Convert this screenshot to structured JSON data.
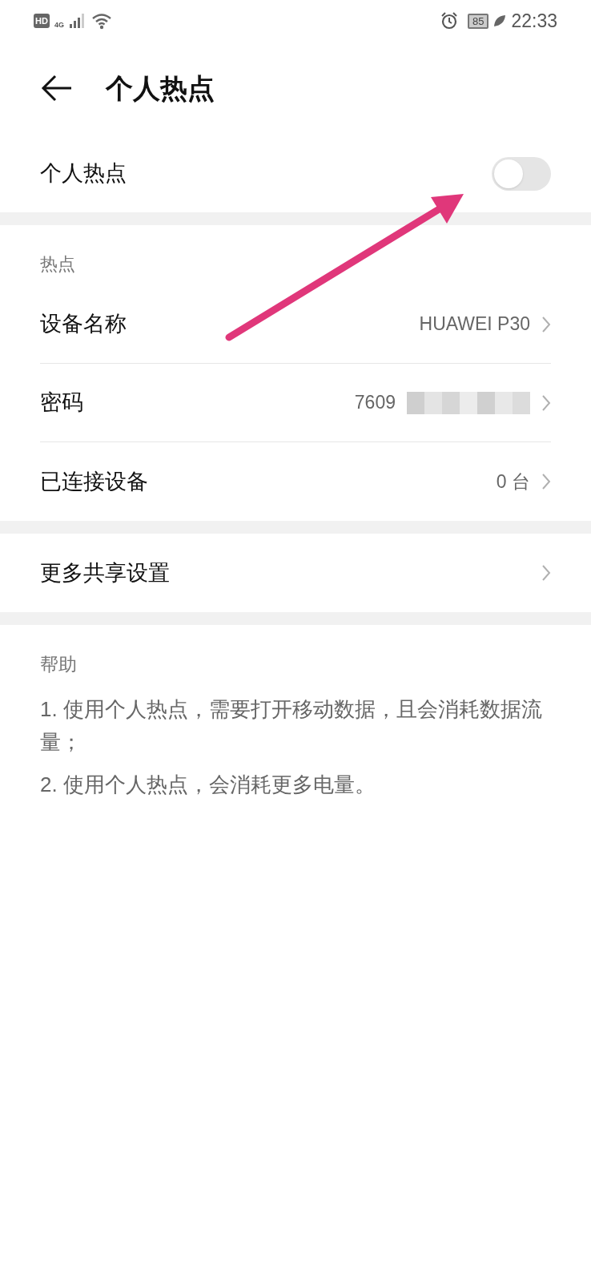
{
  "status_bar": {
    "hd": "HD",
    "network": "4G",
    "battery": "85",
    "time": "22:33"
  },
  "header": {
    "title": "个人热点"
  },
  "hotspot_toggle": {
    "label": "个人热点",
    "on": false
  },
  "hotspot_section": {
    "title": "热点",
    "rows": [
      {
        "label": "设备名称",
        "value": "HUAWEI P30",
        "kind": "text"
      },
      {
        "label": "密码",
        "value": "7609",
        "kind": "masked"
      },
      {
        "label": "已连接设备",
        "value": "0 台",
        "kind": "text"
      }
    ]
  },
  "more_section": {
    "rows": [
      {
        "label": "更多共享设置"
      }
    ]
  },
  "help": {
    "title": "帮助",
    "items": [
      "1. 使用个人热点，需要打开移动数据，且会消耗数据流量；",
      "2. 使用个人热点，会消耗更多电量。"
    ]
  }
}
